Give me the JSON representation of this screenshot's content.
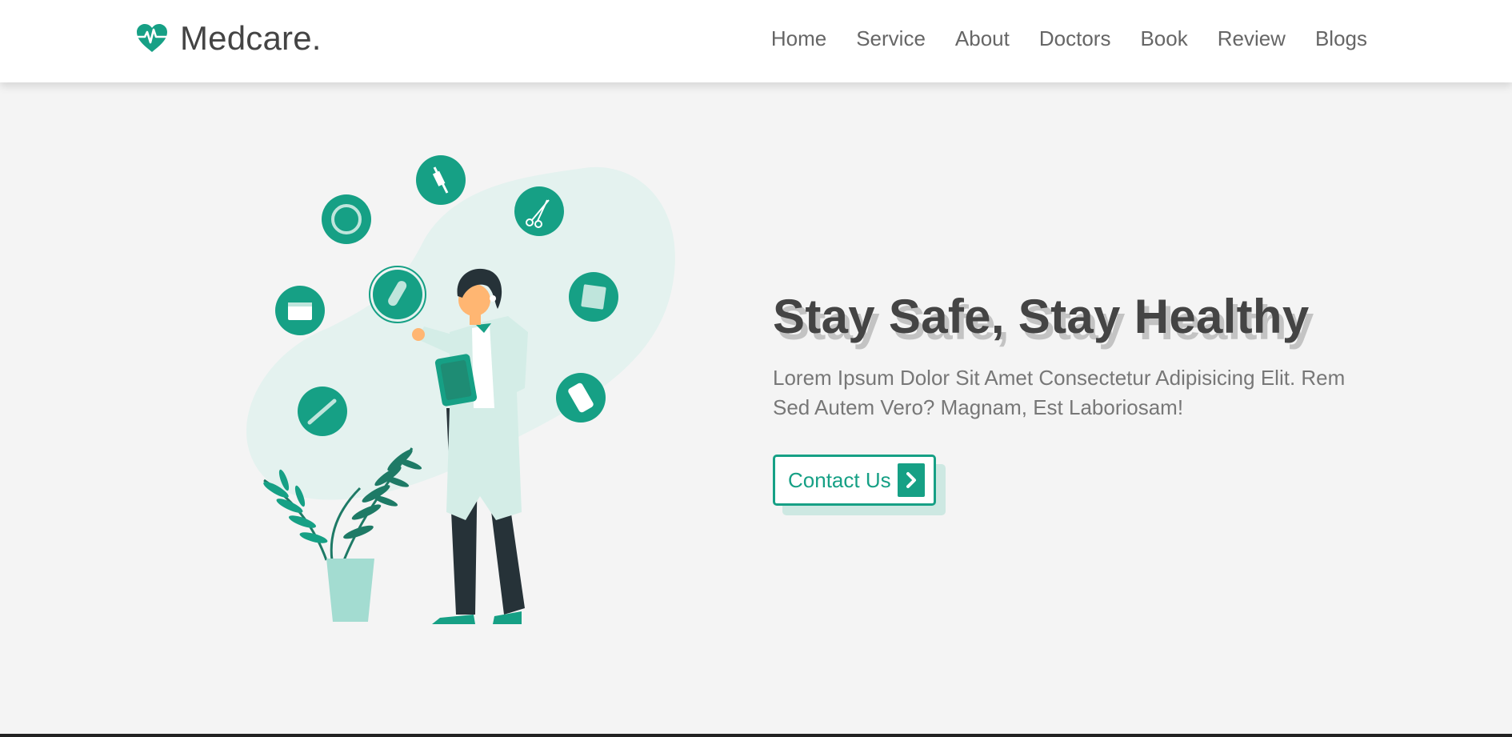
{
  "brand": {
    "name": "Medcare.",
    "icon": "heartbeat-icon",
    "accent": "#16a085"
  },
  "nav": {
    "items": [
      {
        "label": "Home"
      },
      {
        "label": "Service"
      },
      {
        "label": "About"
      },
      {
        "label": "Doctors"
      },
      {
        "label": "Book"
      },
      {
        "label": "Review"
      },
      {
        "label": "Blogs"
      }
    ]
  },
  "hero": {
    "title": "Stay Safe, Stay Healthy",
    "description": "Lorem Ipsum Dolor Sit Amet Consectetur Adipisicing Elit. Rem Sed Autem Vero? Magnam, Est Laboriosam!",
    "cta_label": "Contact Us",
    "cta_icon": "chevron-right-icon",
    "illustration_icons": [
      "ring-icon",
      "syringe-icon",
      "scissors-icon",
      "calendar-icon",
      "capsule-icon",
      "report-icon",
      "thermometer-icon",
      "pill-blister-icon"
    ]
  },
  "colors": {
    "accent": "#16a085",
    "background": "#f4f4f4",
    "navbar": "#ffffff",
    "heading": "#444444",
    "text": "#777777"
  }
}
